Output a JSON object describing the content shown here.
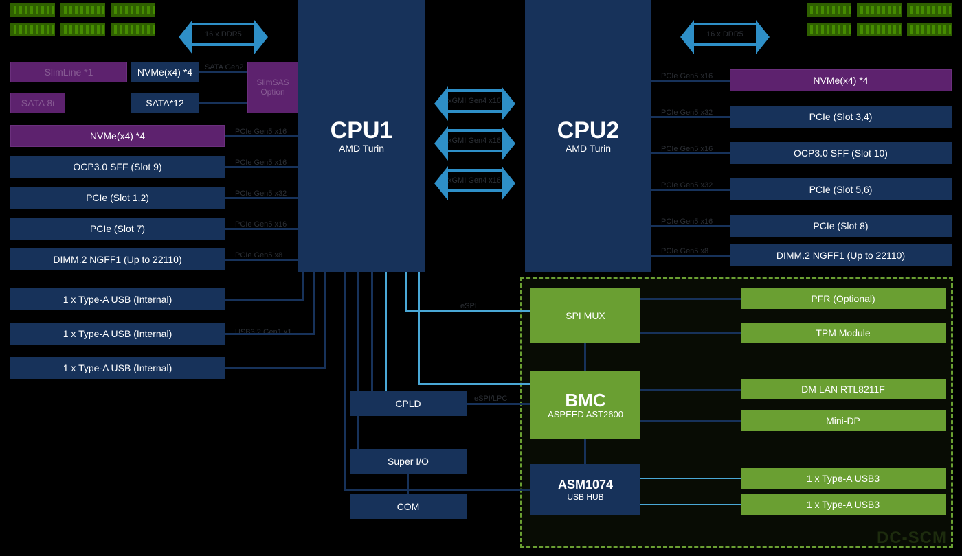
{
  "cpu1": {
    "title": "CPU1",
    "sub": "AMD Turin"
  },
  "cpu2": {
    "title": "CPU2",
    "sub": "AMD Turin"
  },
  "ddr_arrow_label": "16 x DDR5",
  "cpu_links": {
    "l0": "xGMI Gen4 x16",
    "l1": "xGMI Gen4 x16",
    "l2": "xGMI Gen4 x16"
  },
  "slimline": "SlimLine *1",
  "sata8i": "SATA 8i",
  "nvme_inline": "NVMe(x4) *4",
  "sata12": "SATA*12",
  "slimsas": "SlimSAS Option",
  "left": {
    "nvme": "NVMe(x4) *4",
    "ocp": "OCP3.0 SFF (Slot 9)",
    "pcie12": "PCIe (Slot 1,2)",
    "pcie7": "PCIe (Slot 7)",
    "dimm": "DIMM.2 NGFF1 (Up to 22110)",
    "usb_a": "1 x Type-A USB (Internal)",
    "usb_b": "1 x Type-A USB (Internal)",
    "usb_c": "1 x Type-A USB (Internal)"
  },
  "left_lbl": {
    "nvme": "PCIe Gen5 x16",
    "ocp": "PCIe Gen5 x16",
    "pcie12": "PCIe Gen5 x32",
    "pcie7": "PCIe Gen5 x16",
    "dimm": "PCIe Gen5 x8",
    "usb_b": "USB3.2 Gen1 x1",
    "sata": "SATA Gen2"
  },
  "right": {
    "nvme": "NVMe(x4) *4",
    "pcie34": "PCIe (Slot 3,4)",
    "ocp10": "OCP3.0 SFF (Slot 10)",
    "pcie56": "PCIe (Slot 5,6)",
    "pcie8": "PCIe (Slot 8)",
    "dimm": "DIMM.2 NGFF1 (Up to 22110)",
    "pfr": "PFR (Optional)",
    "tpm": "TPM Module",
    "dmlan": "DM LAN RTL8211F",
    "minidp": "Mini-DP",
    "usb3a": "1 x Type-A USB3",
    "usb3b": "1 x Type-A USB3"
  },
  "right_lbl": {
    "nvme": "PCIe Gen5 x16",
    "pcie34": "PCIe Gen5 x32",
    "ocp10": "PCIe Gen5 x16",
    "pcie56": "PCIe Gen5 x32",
    "pcie8": "PCIe Gen5 x16",
    "dimm": "PCIe Gen5 x8"
  },
  "mid": {
    "cpld": "CPLD",
    "superio": "Super I/O",
    "com": "COM",
    "espi": "eSPI",
    "link": "eSPI/LPC"
  },
  "spi_mux": "SPI MUX",
  "bmc": {
    "title": "BMC",
    "sub": "ASPEED AST2600"
  },
  "asm": {
    "title": "ASM1074",
    "sub": "USB HUB"
  },
  "dcscm": "DC-SCM"
}
